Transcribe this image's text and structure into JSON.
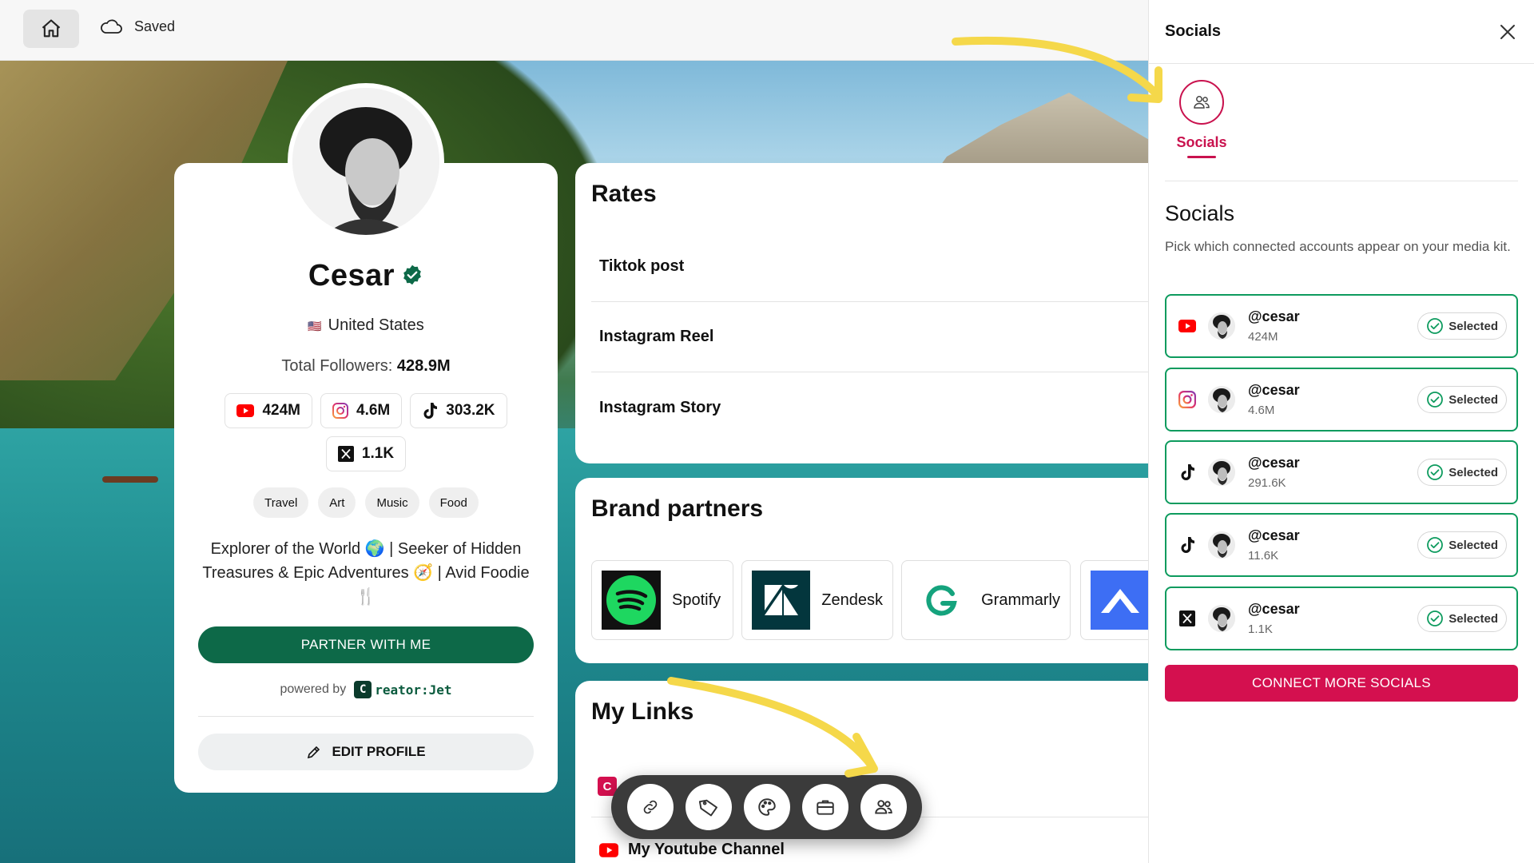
{
  "topbar": {
    "saved_label": "Saved"
  },
  "profile": {
    "name": "Cesar",
    "location": "United States",
    "flag": "🇺🇸",
    "total_followers_label": "Total Followers:",
    "total_followers_value": "428.9M",
    "stats": [
      {
        "platform": "youtube-icon",
        "value": "424M"
      },
      {
        "platform": "instagram-icon",
        "value": "4.6M"
      },
      {
        "platform": "tiktok-icon",
        "value": "303.2K"
      },
      {
        "platform": "x-icon",
        "value": "1.1K"
      }
    ],
    "tags": [
      "Travel",
      "Art",
      "Music",
      "Food"
    ],
    "bio": "Explorer of the World 🌍 | Seeker of Hidden Treasures & Epic Adventures 🧭 | Avid Foodie 🍴",
    "partner_button": "PARTNER WITH ME",
    "powered_by": "powered by",
    "powered_logo": "reator:Jet",
    "powered_logo_mark": "C",
    "edit_button": "EDIT PROFILE"
  },
  "rates": {
    "title": "Rates",
    "items": [
      "Tiktok post",
      "Instagram Reel",
      "Instagram Story"
    ]
  },
  "brands": {
    "title": "Brand partners",
    "items": [
      "Spotify",
      "Zendesk",
      "Grammarly"
    ]
  },
  "links": {
    "title": "My Links",
    "items": [
      "My Youtube Channel"
    ]
  },
  "panel": {
    "title": "Socials",
    "tab_label": "Socials",
    "section_title": "Socials",
    "section_desc": "Pick which connected accounts appear on your media kit.",
    "accounts": [
      {
        "platform": "youtube-icon",
        "handle": "@cesar",
        "count": "424M",
        "status": "Selected"
      },
      {
        "platform": "instagram-icon",
        "handle": "@cesar",
        "count": "4.6M",
        "status": "Selected"
      },
      {
        "platform": "tiktok-icon",
        "handle": "@cesar",
        "count": "291.6K",
        "status": "Selected"
      },
      {
        "platform": "tiktok-icon",
        "handle": "@cesar",
        "count": "11.6K",
        "status": "Selected"
      },
      {
        "platform": "x-icon",
        "handle": "@cesar",
        "count": "1.1K",
        "status": "Selected"
      }
    ],
    "connect_button": "CONNECT MORE SOCIALS"
  },
  "colors": {
    "accent": "#d4104f",
    "primary_green": "#0d6948",
    "selected_border": "#0d9b5e",
    "arrow_yellow": "#f5d84a"
  }
}
